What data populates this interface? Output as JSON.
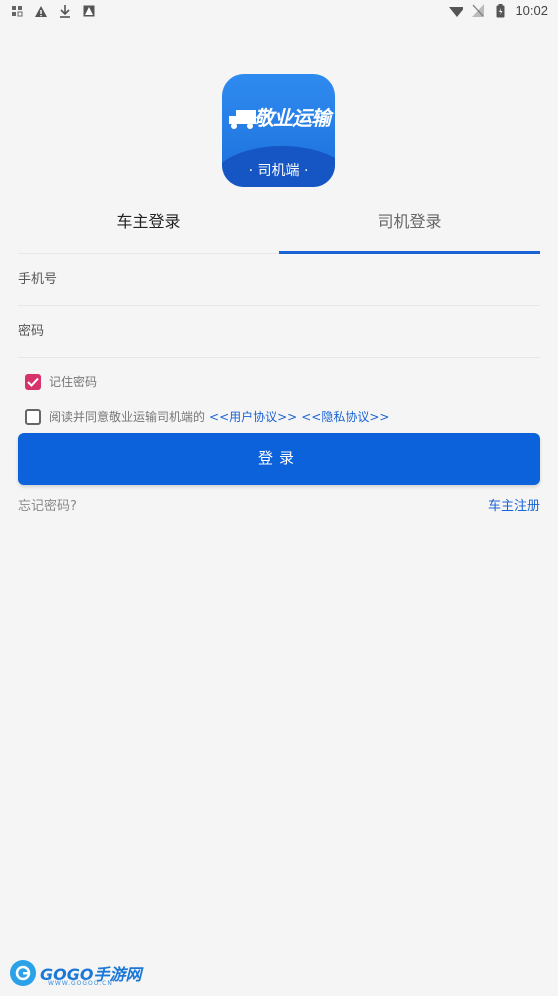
{
  "status_bar": {
    "time": "10:02"
  },
  "logo": {
    "title": "敬业运输",
    "subtitle": "· 司机端 ·"
  },
  "tabs": [
    {
      "label": "车主登录",
      "selected": false
    },
    {
      "label": "司机登录",
      "selected": true
    }
  ],
  "form": {
    "phone_placeholder": "手机号",
    "password_placeholder": "密码",
    "remember_label": "记住密码",
    "remember_checked": true,
    "agree_text": "阅读并同意敬业运输司机端的",
    "user_agreement": "<<用户协议>>",
    "privacy_agreement": "<<隐私协议>>",
    "agree_checked": false,
    "login_label": "登录",
    "forgot_label": "忘记密码?",
    "register_label": "车主注册"
  },
  "watermark": {
    "text": "GOGO手游网",
    "url": "WWW.GOGOO.CN"
  },
  "colors": {
    "accent": "#0c62da",
    "checkbox": "#d6336c"
  }
}
